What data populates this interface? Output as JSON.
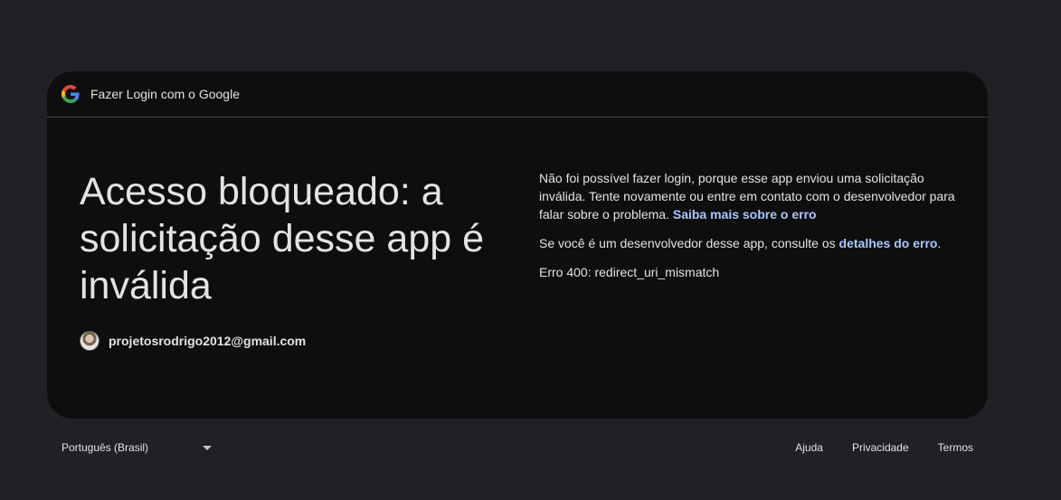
{
  "header": {
    "title": "Fazer Login com o Google",
    "logo_icon": "google-g-icon"
  },
  "main": {
    "headline": "Acesso bloqueado: a solicitação desse app é inválida",
    "account_email": "projetosrodrigo2012@gmail.com",
    "message_text": "Não foi possível fazer login, porque esse app enviou uma solicitação inválida. Tente novamente ou entre em contato com o desenvolvedor para falar sobre o problema.",
    "learn_more_link": "Saiba mais sobre o erro",
    "developer_text": "Se você é um desenvolvedor desse app, consulte os",
    "error_details_link": "detalhes do erro",
    "developer_text_end": ".",
    "error_code": "Erro 400: redirect_uri_mismatch"
  },
  "footer": {
    "language": "Português (Brasil)",
    "links": [
      "Ajuda",
      "Privacidade",
      "Termos"
    ]
  },
  "colors": {
    "page_bg": "#202124",
    "card_bg": "#0e0e0f",
    "link": "#a8c7fa",
    "text": "#e3e3e3"
  }
}
